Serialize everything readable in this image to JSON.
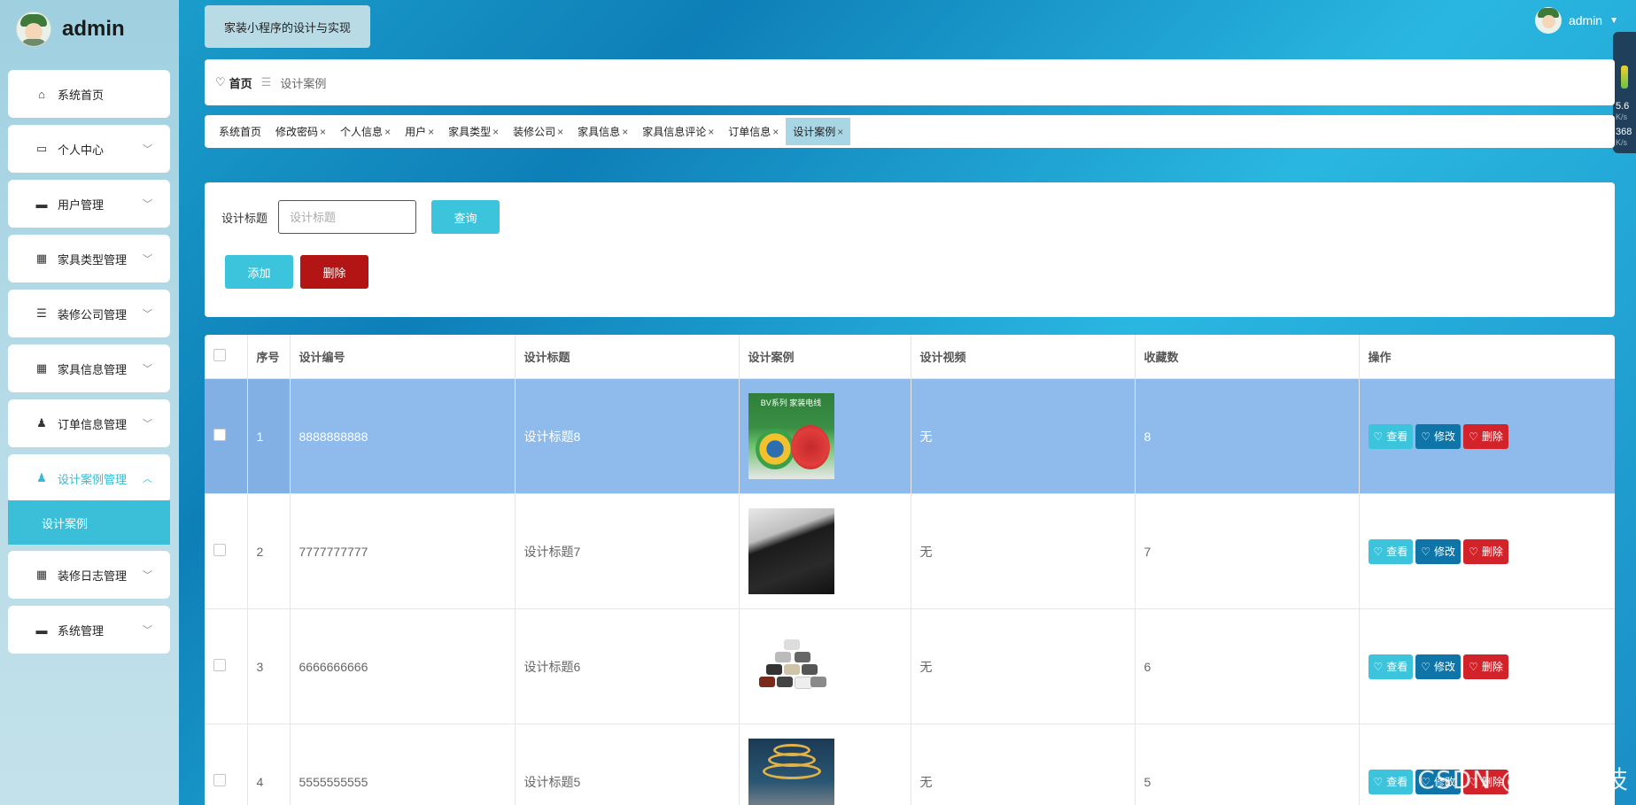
{
  "brand": {
    "name": "admin"
  },
  "sidebar": {
    "items": [
      {
        "label": "系统首页",
        "icon": "home-icon"
      },
      {
        "label": "个人中心",
        "icon": "card-icon"
      },
      {
        "label": "用户管理",
        "icon": "briefcase-icon"
      },
      {
        "label": "家具类型管理",
        "icon": "grid-icon"
      },
      {
        "label": "装修公司管理",
        "icon": "list-icon"
      },
      {
        "label": "家具信息管理",
        "icon": "grid-icon"
      },
      {
        "label": "订单信息管理",
        "icon": "user-icon"
      },
      {
        "label": "设计案例管理",
        "icon": "user-icon"
      },
      {
        "label": "装修日志管理",
        "icon": "grid-icon"
      },
      {
        "label": "系统管理",
        "icon": "monitor-icon"
      }
    ],
    "submenu": {
      "label": "设计案例"
    }
  },
  "header": {
    "title": "家装小程序的设计与实现",
    "user": "admin"
  },
  "side_widget": {
    "v1": "5.6",
    "v1_unit": "K/s",
    "v2": "368",
    "v2_unit": "K/s"
  },
  "breadcrumb": {
    "home": "首页",
    "current": "设计案例"
  },
  "tabs": [
    {
      "label": "系统首页",
      "closable": false
    },
    {
      "label": "修改密码",
      "closable": true
    },
    {
      "label": "个人信息",
      "closable": true
    },
    {
      "label": "用户",
      "closable": true
    },
    {
      "label": "家具类型",
      "closable": true
    },
    {
      "label": "装修公司",
      "closable": true
    },
    {
      "label": "家具信息",
      "closable": true
    },
    {
      "label": "家具信息评论",
      "closable": true
    },
    {
      "label": "订单信息",
      "closable": true
    },
    {
      "label": "设计案例",
      "closable": true
    }
  ],
  "search": {
    "label": "设计标题",
    "placeholder": "设计标题",
    "query_label": "查询",
    "add_label": "添加",
    "delete_label": "删除"
  },
  "table": {
    "columns": [
      "序号",
      "设计编号",
      "设计标题",
      "设计案例",
      "设计视频",
      "收藏数",
      "操作"
    ],
    "rows": [
      {
        "index": "1",
        "code": "8888888888",
        "title": "设计标题8",
        "video": "无",
        "favorites": "8"
      },
      {
        "index": "2",
        "code": "7777777777",
        "title": "设计标题7",
        "video": "无",
        "favorites": "7"
      },
      {
        "index": "3",
        "code": "6666666666",
        "title": "设计标题6",
        "video": "无",
        "favorites": "6"
      },
      {
        "index": "4",
        "code": "5555555555",
        "title": "设计标题5",
        "video": "无",
        "favorites": "5"
      }
    ],
    "actions": {
      "view": "查看",
      "edit": "修改",
      "delete": "删除"
    },
    "thumb1_text": "BV系列 家装电线"
  },
  "watermark": "CSDN @辉时科技"
}
